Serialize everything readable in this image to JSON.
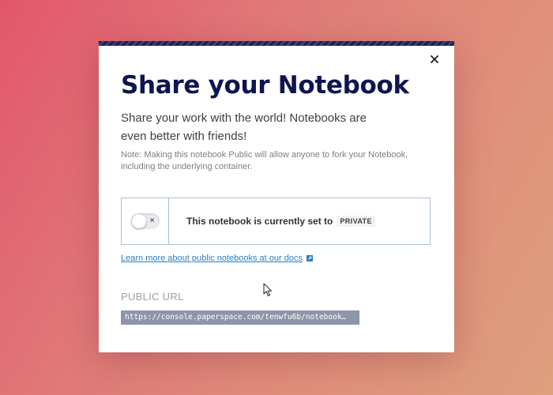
{
  "modal": {
    "title": "Share your Notebook",
    "subtitle": "Share your work with the world! Notebooks are even better with friends!",
    "note": "Note: Making this notebook Public will allow anyone to fork your Notebook, including the underlying container.",
    "close_icon": "close-icon"
  },
  "visibility": {
    "toggle_on": false,
    "toggle_off_glyph": "×",
    "status_text": "This notebook is currently set to",
    "status_badge": "PRIVATE"
  },
  "docs_link": {
    "label": "Learn more about public notebooks at our docs",
    "icon": "external-link-icon"
  },
  "public_url": {
    "label": "PUBLIC URL",
    "value": "https://console.paperspace.com/tenwfu6b/notebook…"
  },
  "colors": {
    "title": "#0e1550",
    "link": "#2f7fc0",
    "card_border": "#a9bfd3",
    "url_field_bg": "#8d96a8"
  }
}
